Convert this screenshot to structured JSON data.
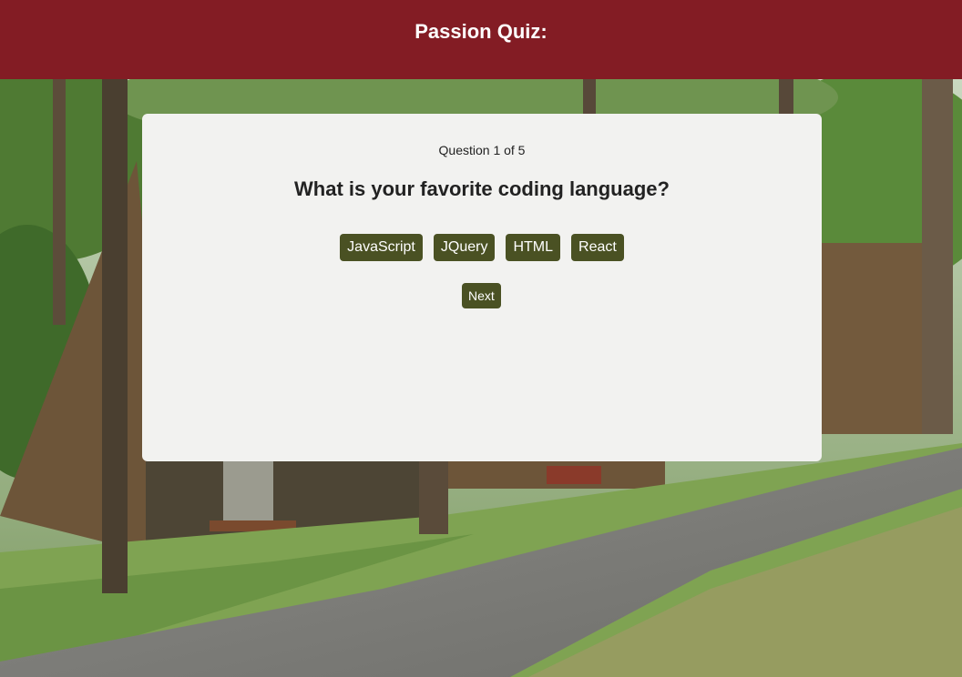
{
  "header": {
    "title": "Passion Quiz:"
  },
  "quiz": {
    "progress": "Question 1 of 5",
    "question": "What is your favorite coding language?",
    "choices": [
      "JavaScript",
      "JQuery",
      "HTML",
      "React"
    ],
    "next_label": "Next"
  },
  "colors": {
    "header_bg": "#831c24",
    "button_bg": "#4a5123",
    "card_bg": "#f2f2f0"
  }
}
